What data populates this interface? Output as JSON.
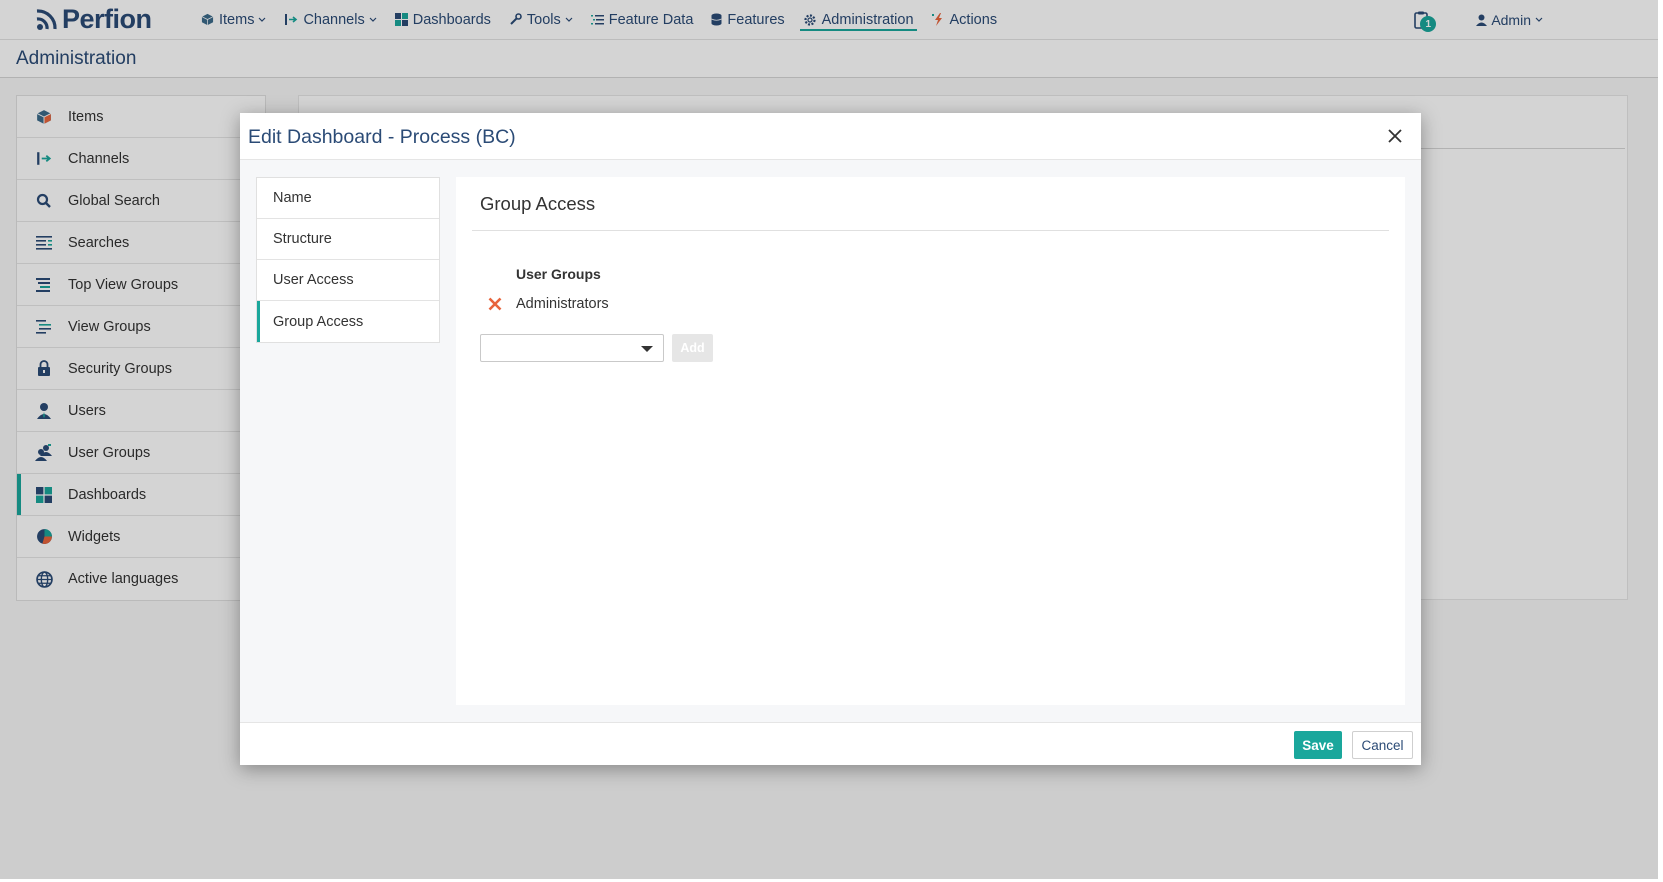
{
  "app": {
    "logo_text": "Perfion"
  },
  "nav": {
    "items": [
      {
        "label": "Items",
        "icon": "cube-icon",
        "dropdown": true
      },
      {
        "label": "Channels",
        "icon": "channel-arrow-icon",
        "dropdown": true
      },
      {
        "label": "Dashboards",
        "icon": "dashboard-grid-icon",
        "dropdown": false
      },
      {
        "label": "Tools",
        "icon": "wrench-icon",
        "dropdown": true
      },
      {
        "label": "Feature Data",
        "icon": "list-icon",
        "dropdown": false
      },
      {
        "label": "Features",
        "icon": "database-icon",
        "dropdown": false
      },
      {
        "label": "Administration",
        "icon": "gear-icon",
        "dropdown": false,
        "active": true
      },
      {
        "label": "Actions",
        "icon": "lightning-icon",
        "dropdown": false
      }
    ],
    "notifications_count": "1",
    "user_label": "Admin"
  },
  "page": {
    "title": "Administration"
  },
  "sidebar": {
    "items": [
      {
        "label": "Items",
        "icon": "cube-icon"
      },
      {
        "label": "Channels",
        "icon": "channel-arrow-icon"
      },
      {
        "label": "Global Search",
        "icon": "search-icon"
      },
      {
        "label": "Searches",
        "icon": "searches-list-icon"
      },
      {
        "label": "Top View Groups",
        "icon": "top-view-groups-icon"
      },
      {
        "label": "View Groups",
        "icon": "view-groups-icon"
      },
      {
        "label": "Security Groups",
        "icon": "lock-icon"
      },
      {
        "label": "Users",
        "icon": "user-icon"
      },
      {
        "label": "User Groups",
        "icon": "user-groups-icon"
      },
      {
        "label": "Dashboards",
        "icon": "dashboard-grid-icon",
        "active": true
      },
      {
        "label": "Widgets",
        "icon": "pie-chart-icon"
      },
      {
        "label": "Active languages",
        "icon": "globe-icon"
      }
    ]
  },
  "modal": {
    "title": "Edit Dashboard - Process (BC)",
    "tabs": [
      {
        "label": "Name"
      },
      {
        "label": "Structure"
      },
      {
        "label": "User Access"
      },
      {
        "label": "Group Access",
        "active": true
      }
    ],
    "panel_title": "Group Access",
    "user_groups_header": "User Groups",
    "groups": [
      {
        "label": "Administrators"
      }
    ],
    "select_value": "",
    "add_label": "Add",
    "save_label": "Save",
    "cancel_label": "Cancel"
  },
  "colors": {
    "accent": "#1aa79c",
    "brand": "#2b4b76",
    "remove": "#e8643c"
  }
}
